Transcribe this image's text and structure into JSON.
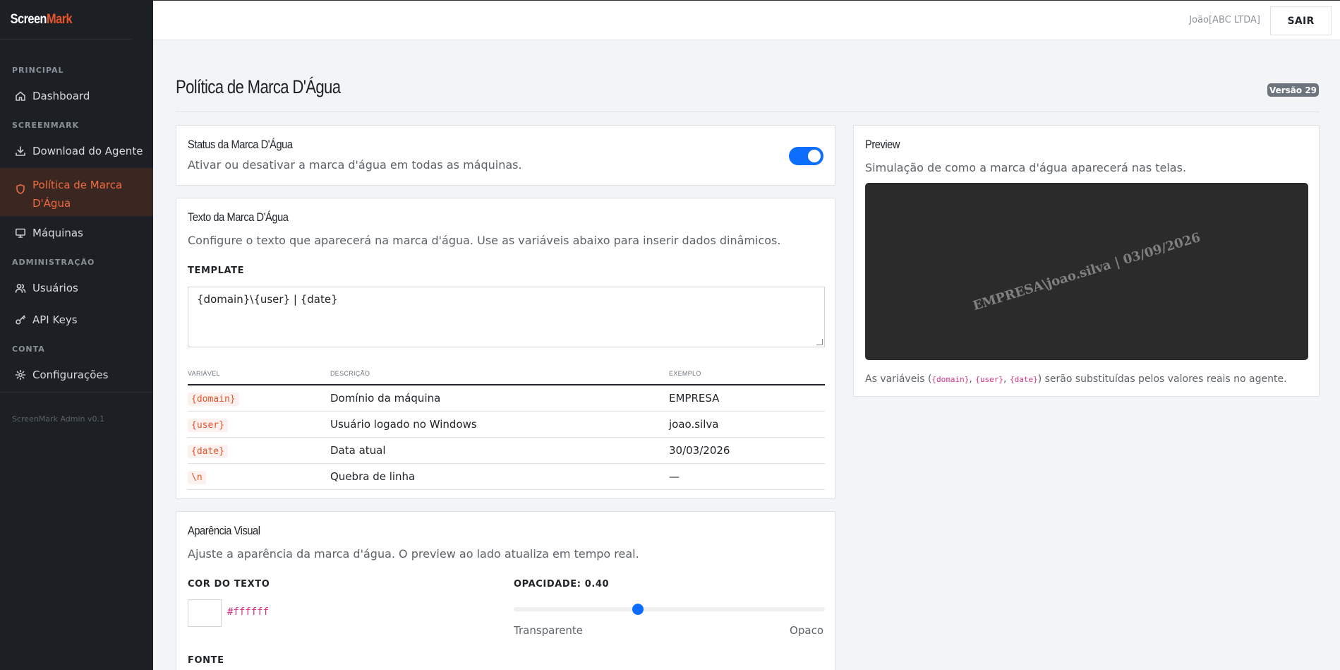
{
  "brand": {
    "part1": "Screen",
    "part2": "Mark"
  },
  "sidebar": {
    "sections": [
      {
        "title": "PRINCIPAL"
      },
      {
        "title": "SCREENMARK"
      },
      {
        "title": "ADMINISTRAÇÃO"
      },
      {
        "title": "CONTA"
      }
    ],
    "items": [
      {
        "label": "Dashboard",
        "icon": "home-icon"
      },
      {
        "label": "Download do Agente",
        "icon": "download-icon"
      },
      {
        "label": "Política de Marca D'Água",
        "icon": "shield-icon",
        "active": true
      },
      {
        "label": "Máquinas",
        "icon": "monitor-icon"
      },
      {
        "label": "Usuários",
        "icon": "users-icon"
      },
      {
        "label": "API Keys",
        "icon": "key-icon"
      },
      {
        "label": "Configurações",
        "icon": "gear-icon"
      }
    ],
    "version": "ScreenMark Admin v0.1"
  },
  "topbar": {
    "user": "João[ABC LTDA]",
    "logout": "SAIR"
  },
  "page": {
    "title": "Política de Marca D'Água",
    "version_badge": "Versão 29"
  },
  "status_card": {
    "title": "Status da Marca D'Água",
    "subtitle": "Ativar ou desativar a marca d'água em todas as máquinas.",
    "enabled": true
  },
  "text_card": {
    "title": "Texto da Marca D'Água",
    "subtitle": "Configure o texto que aparecerá na marca d'água. Use as variáveis abaixo para inserir dados dinâmicos.",
    "template_label": "TEMPLATE",
    "template_value": "{domain}\\{user} | {date}",
    "columns": [
      "VARIÁVEL",
      "DESCRIÇÃO",
      "EXEMPLO"
    ],
    "rows": [
      {
        "var": "{domain}",
        "desc": "Domínio da máquina",
        "example": "EMPRESA"
      },
      {
        "var": "{user}",
        "desc": "Usuário logado no Windows",
        "example": "joao.silva"
      },
      {
        "var": "{date}",
        "desc": "Data atual",
        "example": "30/03/2026"
      },
      {
        "var": "\\n",
        "desc": "Quebra de linha",
        "example": "—"
      }
    ]
  },
  "preview_card": {
    "title": "Preview",
    "subtitle": "Simulação de como a marca d'água aparecerá nas telas.",
    "watermark_text": "EMPRESA\\joao.silva | 03/09/2026",
    "note_prefix": "As variáveis (",
    "note_vars": [
      "{domain}",
      "{user}",
      "{date}"
    ],
    "note_suffix": ") serão substituídas pelos valores reais no agente."
  },
  "appearance_card": {
    "title": "Aparência Visual",
    "subtitle": "Ajuste a aparência da marca d'água. O preview ao lado atualiza em tempo real.",
    "color_label": "COR DO TEXTO",
    "color_value": "#ffffff",
    "opacity_label": "OPACIDADE:",
    "opacity_value": "0.40",
    "opacity_fraction": 0.4,
    "min_label": "Transparente",
    "max_label": "Opaco",
    "font_label": "FONTE"
  },
  "colors": {
    "accent": "#e8542a",
    "primary": "#0d6efd",
    "sidebar_bg": "#1c2024"
  }
}
